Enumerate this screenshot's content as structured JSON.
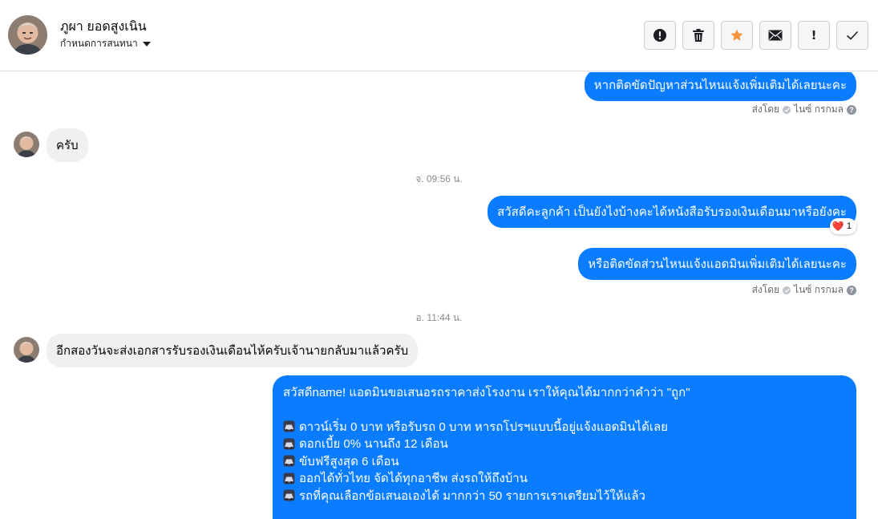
{
  "header": {
    "contact_name": "ภูผา ยอดสูงเนิน",
    "assign_label": "กำหนดการสนทนา",
    "toolbar": [
      {
        "name": "spam-report-button",
        "icon": "exclamation-circle-icon"
      },
      {
        "name": "delete-button",
        "icon": "trash-icon"
      },
      {
        "name": "star-button",
        "icon": "star-icon"
      },
      {
        "name": "mark-unread-button",
        "icon": "envelope-icon"
      },
      {
        "name": "follow-up-button",
        "icon": "exclamation-icon"
      },
      {
        "name": "done-button",
        "icon": "checkmark-icon"
      }
    ]
  },
  "colors": {
    "outgoing_bubble": "#0a7cff",
    "incoming_bubble": "#f0f0f0",
    "star": "#f7923b"
  },
  "messages": {
    "m1_text": "หากติดขัดปัญหาส่วนไหนแจ้งเพิ่มเติมได้เลยนะคะ",
    "m1_sent_by_label": "ส่งโดย",
    "m1_sender": "ไนซ์ กรกมล",
    "m2_text": "ครับ",
    "ts1": "จ. 09:56 น.",
    "m3_text": "สวัสดีคะลูกค้า เป็นยังไงบ้างคะได้หนังสือรับรองเงินเดือนมาหรือยังคะ",
    "m3_reaction_emoji": "❤️",
    "m3_reaction_count": "1",
    "m4_text": "หรือติดขัดส่วนไหนแจ้งแอดมินเพิ่มเติมได้เลยนะคะ",
    "m4_sent_by_label": "ส่งโดย",
    "m4_sender": "ไนซ์ กรกมล",
    "ts2": "อ. 11:44 น.",
    "m5_text": "อีกสองวันจะส่งเอกสารรับรองเงินเดือนไห้ครับเจ้านายกลับมาแล้วครับ",
    "m6_intro": "สวัสดีname! แอดมินขอเสนอรถราคาส่งโรงงาน เราให้คุณได้มากกว่าคำว่า \"ถูก\"",
    "m6_bullets": [
      "ดาวน์เริ่ม 0 บาท หรือรับรถ 0 บาท หารถโปรฯแบบนี้อยู่แจ้งแอดมินได้เลย",
      "ดอกเบี้ย 0% นานถึง 12 เดือน",
      "ขับฟรีสูงสุด 6 เดือน",
      "ออกได้ทั่วไทย จัดได้ทุกอาชีพ ส่งรถให้ถึงบ้าน",
      "รถที่คุณเลือกข้อเสนอเองได้ มากกว่า 50 รายการเราเตรียมไว้ให้แล้ว"
    ],
    "m6_bullet_icon": "car-icon"
  }
}
